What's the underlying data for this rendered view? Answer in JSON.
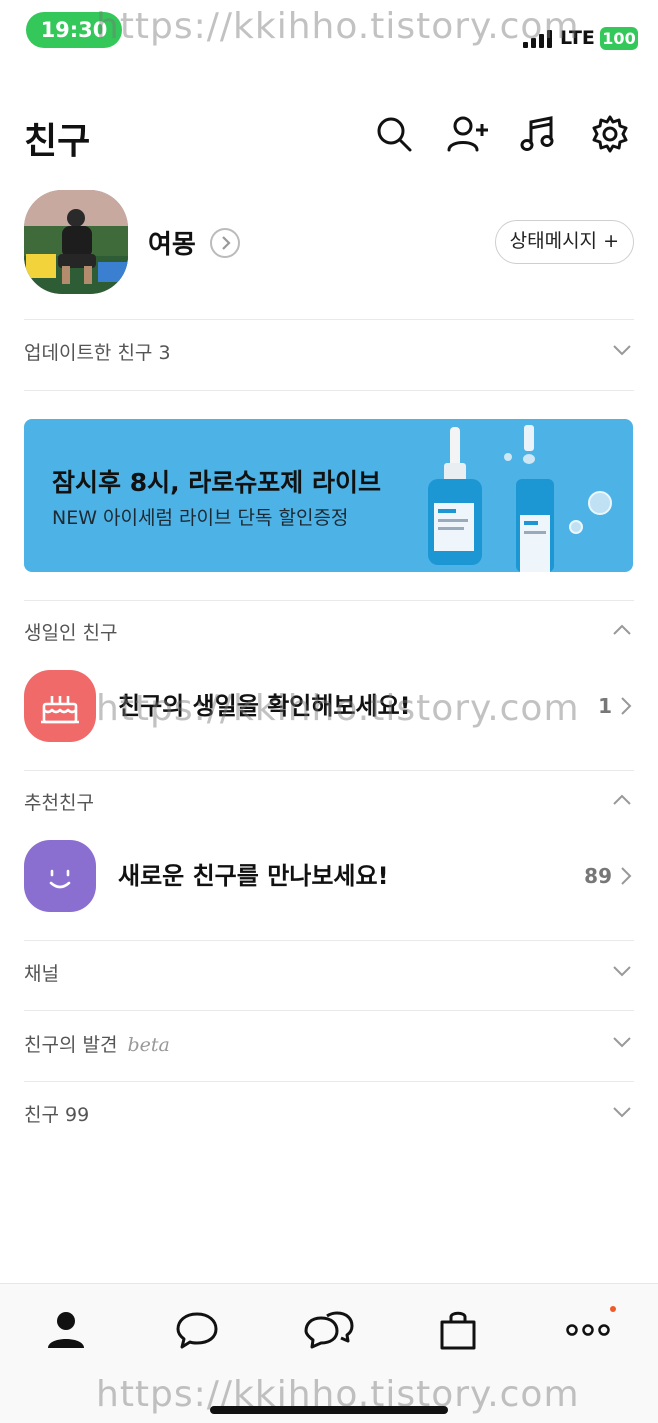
{
  "status_bar": {
    "time": "19:30",
    "network": "LTE",
    "battery": "100"
  },
  "watermark": "https://kkihho.tistory.com",
  "header": {
    "title": "친구",
    "icons": [
      "search-icon",
      "add-friend-icon",
      "music-icon",
      "settings-icon"
    ]
  },
  "profile": {
    "name": "여몽",
    "status_button": "상태메시지 +"
  },
  "updated_friends": {
    "label": "업데이트한 친구 3"
  },
  "banner": {
    "title": "잠시후 8시, 라로슈포제 라이브",
    "subtitle": "NEW 아이세럼 라이브 단독 할인증정"
  },
  "birthday": {
    "section_label": "생일인 친구",
    "text": "친구의 생일을 확인해보세요!",
    "count": "1"
  },
  "recommended": {
    "section_label": "추천친구",
    "text": "새로운 친구를 만나보세요!",
    "count": "89"
  },
  "channel": {
    "label": "채널"
  },
  "discover": {
    "label": "친구의 발견",
    "badge": "beta"
  },
  "friends": {
    "label": "친구 99"
  },
  "tabbar": {
    "tabs": [
      "friends-tab-icon",
      "chats-tab-icon",
      "openchat-tab-icon",
      "shopping-tab-icon",
      "more-tab-icon"
    ]
  },
  "colors": {
    "accent_green": "#34c759",
    "banner_blue": "#4db3e6",
    "birthday_red": "#f06a6a",
    "recommend_purple": "#8a6fd1",
    "notify_dot": "#f05a2a"
  }
}
